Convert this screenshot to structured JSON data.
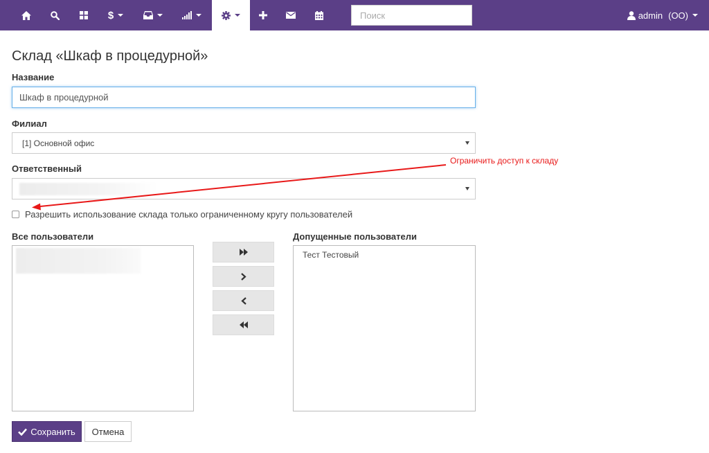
{
  "nav": {
    "search_placeholder": "Поиск",
    "user": {
      "name": "admin",
      "org": "(OO)"
    },
    "brand_color": "#5b3f87",
    "items": [
      {
        "icon": "home-icon"
      },
      {
        "icon": "search-icon"
      },
      {
        "icon": "grid-icon"
      },
      {
        "icon": "dollar-icon",
        "label": "$",
        "dropdown": true
      },
      {
        "icon": "inbox-icon",
        "dropdown": true
      },
      {
        "icon": "signal-icon",
        "dropdown": true
      },
      {
        "icon": "gear-icon",
        "dropdown": true,
        "active": true
      },
      {
        "icon": "plus-icon"
      },
      {
        "icon": "envelope-icon"
      },
      {
        "icon": "calendar-icon"
      }
    ]
  },
  "page": {
    "title": "Склад «Шкаф в процедурной»"
  },
  "form": {
    "name_label": "Название",
    "name_value": "Шкаф в процедурной",
    "branch_label": "Филиал",
    "branch_value": "[1] Основной офис",
    "responsible_label": "Ответственный",
    "restrict_checkbox_label": "Разрешить использование склада только ограниченному кругу пользователей",
    "restrict_checked": false,
    "annotation": "Ограничить доступ к складу",
    "annotation_color": "#e81818",
    "all_users_label": "Все пользователи",
    "allowed_users_label": "Допущенные пользователи",
    "allowed_users": [
      "Тест Тестовый"
    ],
    "save_label": "Сохранить",
    "cancel_label": "Отмена"
  }
}
